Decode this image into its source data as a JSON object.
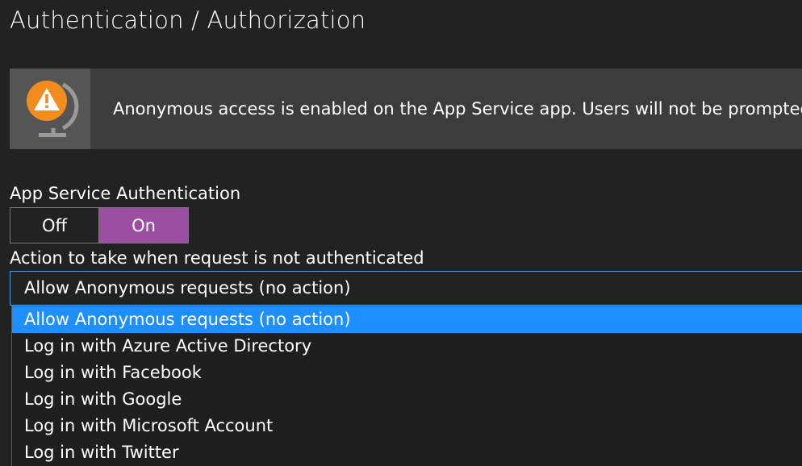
{
  "page": {
    "title": "Authentication / Authorization"
  },
  "banner": {
    "icon": "warning-globe-icon",
    "message": "Anonymous access is enabled on the App Service app. Users will not be prompted"
  },
  "auth_toggle": {
    "label": "App Service Authentication",
    "off_label": "Off",
    "on_label": "On",
    "selected": "On",
    "on_color": "#9b4fa3"
  },
  "action": {
    "label": "Action to take when request is not authenticated",
    "selected_value": "Allow Anonymous requests (no action)",
    "options": [
      "Allow Anonymous requests (no action)",
      "Log in with Azure Active Directory",
      "Log in with Facebook",
      "Log in with Google",
      "Log in with Microsoft Account",
      "Log in with Twitter"
    ],
    "highlight_color": "#1e8fff"
  }
}
